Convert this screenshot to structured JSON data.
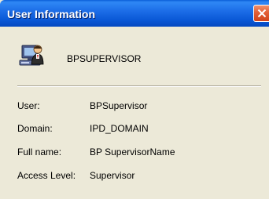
{
  "window": {
    "title": "User Information"
  },
  "header": {
    "user_name": "BPSUPERVISOR",
    "icon": "user-computer-icon"
  },
  "fields": [
    {
      "label": "User:",
      "value": "BPSupervisor"
    },
    {
      "label": "Domain:",
      "value": "IPD_DOMAIN"
    },
    {
      "label": "Full name:",
      "value": "BP SupervisorName"
    },
    {
      "label": "Access Level:",
      "value": "Supervisor"
    }
  ],
  "colors": {
    "titlebar": "#0a5fd8",
    "close_button": "#e35f35",
    "dialog_background": "#ece9d8"
  }
}
